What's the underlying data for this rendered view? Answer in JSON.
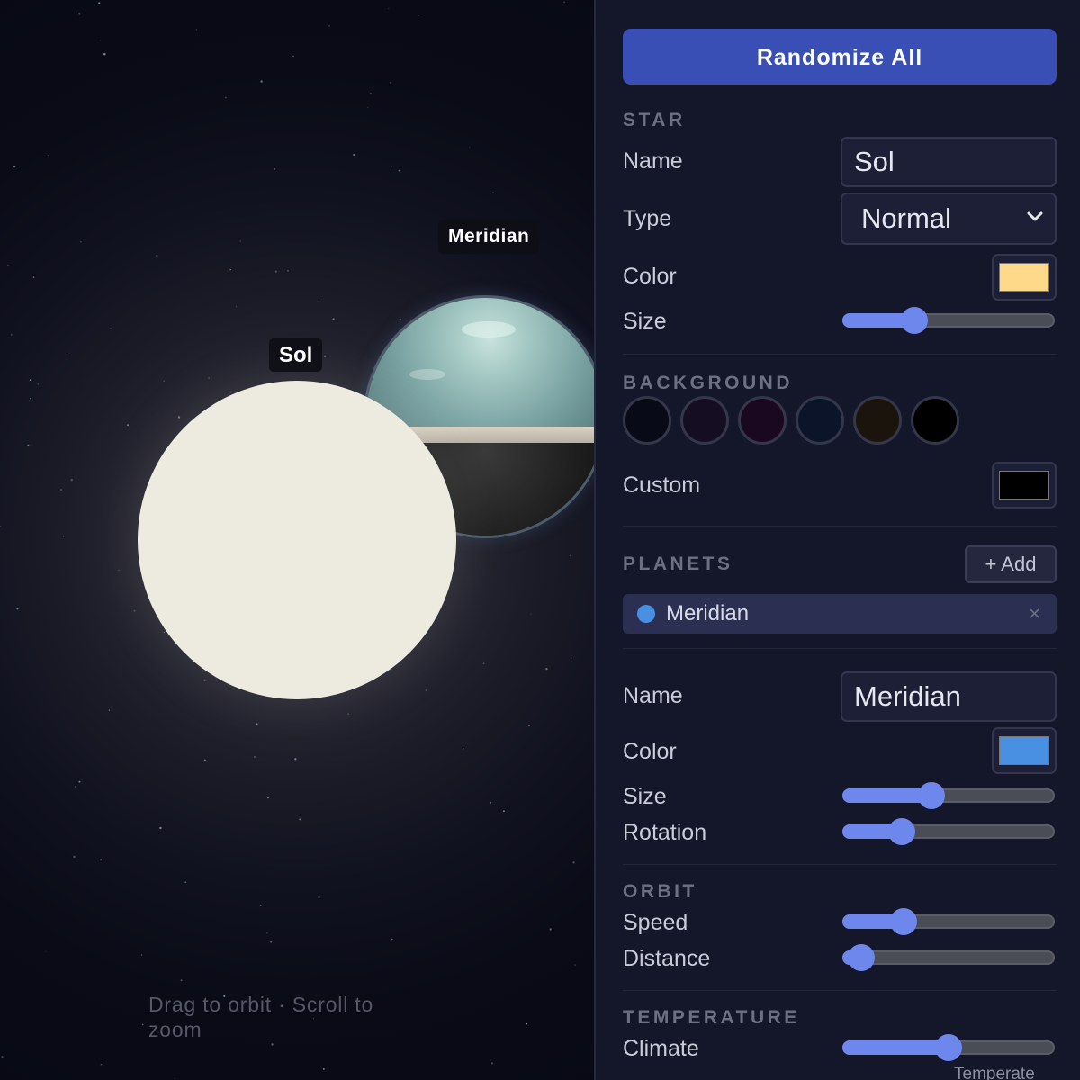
{
  "viewport": {
    "star_label": "Sol",
    "planet_label": "Meridian",
    "hint": "Drag to orbit · Scroll to zoom"
  },
  "panel": {
    "randomize_label": "Randomize All",
    "star": {
      "section_title": "STAR",
      "name_label": "Name",
      "name_value": "Sol",
      "type_label": "Type",
      "type_value": "Normal",
      "color_label": "Color",
      "color_value": "#ffd98a",
      "size_label": "Size",
      "size_level": 0.34
    },
    "background": {
      "section_title": "BACKGROUND",
      "presets": [
        "#080a17",
        "#150e23",
        "#1a0720",
        "#0c1429",
        "#1a140d",
        "#000000"
      ],
      "custom_label": "Custom",
      "custom_value": "#000000"
    },
    "planets": {
      "section_title": "PLANETS",
      "add_label": "+ Add",
      "items": [
        {
          "name": "Meridian",
          "color": "#4a90e2",
          "remove_glyph": "×"
        }
      ]
    },
    "planet": {
      "name_label": "Name",
      "name_value": "Meridian",
      "color_label": "Color",
      "color_value": "#4a90e2",
      "size_label": "Size",
      "size_level": 0.42,
      "rotation_label": "Rotation",
      "rotation_level": 0.28
    },
    "orbit": {
      "section_title": "ORBIT",
      "speed_label": "Speed",
      "speed_level": 0.29,
      "distance_label": "Distance",
      "distance_level": 0.09
    },
    "temperature": {
      "section_title": "TEMPERATURE",
      "climate_label": "Climate",
      "climate_level": 0.5,
      "climate_value": "Temperate"
    }
  }
}
